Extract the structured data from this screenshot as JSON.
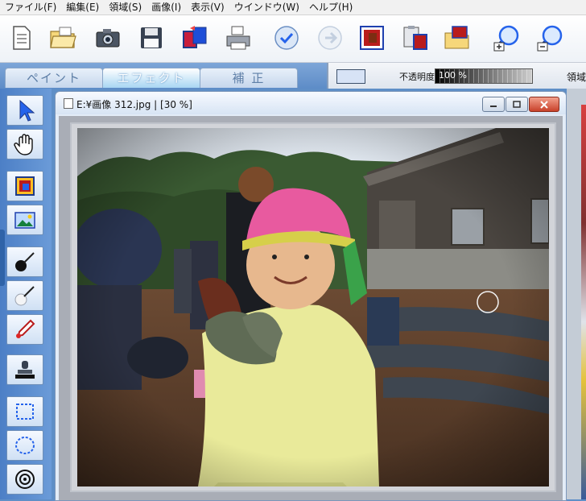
{
  "menu": [
    "ファイル(F)",
    "編集(E)",
    "領域(S)",
    "画像(I)",
    "表示(V)",
    "ウインドウ(W)",
    "ヘルプ(H)"
  ],
  "tabs": [
    {
      "label": "ペイント",
      "active": false
    },
    {
      "label": "エフェクト",
      "active": true
    },
    {
      "label": "補 正",
      "active": false
    }
  ],
  "properties": {
    "opacity_label": "不透明度",
    "opacity_value": "100 %",
    "opacity": 1.0,
    "region_label": "領域"
  },
  "document": {
    "title": "E:¥画像 312.jpg |   [30 %]"
  },
  "toolbar_icons": [
    "new-document-icon",
    "open-folder-icon",
    "camera-icon",
    "save-disk-icon",
    "image-flip-icon",
    "print-icon",
    "undo-icon",
    "redo-icon",
    "image-frame-icon",
    "clipboard-paste-icon",
    "folder-image-icon",
    "zoom-in-icon",
    "zoom-out-icon"
  ],
  "tools": [
    "pointer-arrow-icon",
    "hand-pan-icon",
    "color-swatch-icon",
    "image-layer-icon",
    "brush-dark-icon",
    "brush-light-icon",
    "dropper-icon",
    "stamp-icon",
    "rect-select-icon",
    "ellipse-select-icon",
    "target-ring-icon"
  ],
  "colors": {
    "accent": "#5f8fc7",
    "tab_active": "#a8d6f3",
    "close_button": "#c8412a",
    "cap_pink": "#e85a9f"
  }
}
